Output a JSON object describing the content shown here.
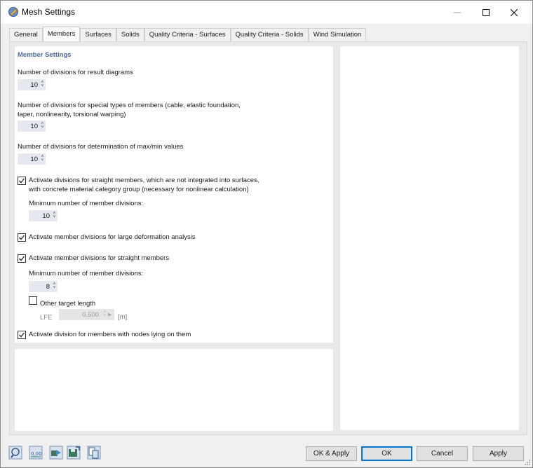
{
  "window": {
    "title": "Mesh Settings"
  },
  "tabs": [
    "General",
    "Members",
    "Surfaces",
    "Solids",
    "Quality Criteria - Surfaces",
    "Quality Criteria - Solids",
    "Wind Simulation"
  ],
  "member_settings": {
    "section_title": "Member Settings",
    "result_diagrams_label": "Number of divisions for result diagrams",
    "result_diagrams_value": "10",
    "special_types_label_1": "Number of divisions for special types of members (cable, elastic foundation,",
    "special_types_label_2": "taper, nonlinearity, torsional warping)",
    "special_types_value": "10",
    "maxmin_label": "Number of divisions for determination of max/min values",
    "maxmin_value": "10",
    "concrete_check_label_1": "Activate divisions for straight members, which are not integrated into surfaces,",
    "concrete_check_label_2": "with concrete material category group (necessary for nonlinear calculation)",
    "concrete_checked": true,
    "concrete_min_label": "Minimum number of member divisions:",
    "concrete_min_value": "10",
    "large_deformation_label": "Activate member divisions for large deformation analysis",
    "large_deformation_checked": true,
    "straight_members_label": "Activate member divisions for straight members",
    "straight_members_checked": true,
    "straight_min_label": "Minimum number of member divisions:",
    "straight_min_value": "8",
    "other_target_label": "Other target length",
    "other_target_checked": false,
    "lfe_label": "LFE",
    "lfe_value": "0.500",
    "lfe_unit": "[m]",
    "nodes_label": "Activate division for members with nodes lying on them",
    "nodes_checked": true
  },
  "buttons": {
    "ok_apply": "OK & Apply",
    "ok": "OK",
    "cancel": "Cancel",
    "apply": "Apply"
  },
  "toolbar_icons": [
    "help-icon",
    "units-icon",
    "import-icon",
    "save-settings-icon",
    "copy-icon"
  ],
  "colors": {
    "accent": "#0078d7",
    "section_title": "#4a6aa0",
    "spin_bg": "#e6e8f0"
  }
}
